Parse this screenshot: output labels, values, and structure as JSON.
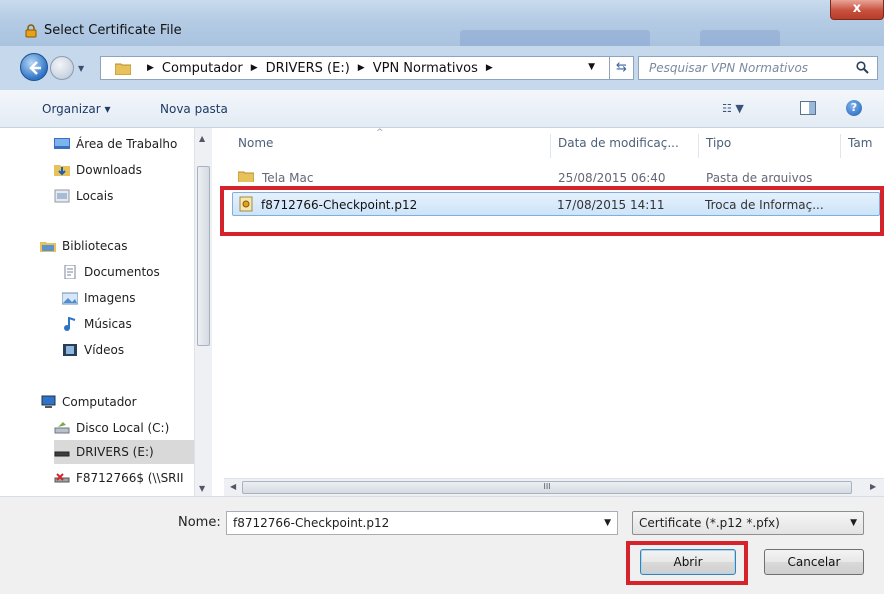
{
  "window": {
    "title": "Select Certificate File",
    "close_label": "x"
  },
  "address": {
    "path": [
      "Computador",
      "DRIVERS (E:)",
      "VPN Normativos"
    ],
    "search_placeholder": "Pesquisar VPN Normativos"
  },
  "toolbar": {
    "organize": "Organizar ▾",
    "new_folder": "Nova pasta"
  },
  "nav": {
    "items": [
      {
        "label": "Área de Trabalho",
        "icon": "desktop-icon"
      },
      {
        "label": "Downloads",
        "icon": "downloads-icon"
      },
      {
        "label": "Locais",
        "icon": "places-icon"
      },
      {
        "label": "Bibliotecas",
        "icon": "libraries-icon"
      },
      {
        "label": "Documentos",
        "icon": "documents-icon"
      },
      {
        "label": "Imagens",
        "icon": "images-icon"
      },
      {
        "label": "Músicas",
        "icon": "music-icon"
      },
      {
        "label": "Vídeos",
        "icon": "videos-icon"
      },
      {
        "label": "Computador",
        "icon": "computer-icon"
      },
      {
        "label": "Disco Local (C:)",
        "icon": "disk-icon"
      },
      {
        "label": "DRIVERS (E:)",
        "icon": "drive-icon"
      },
      {
        "label": "F8712766$ (\\\\SRII",
        "icon": "network-drive-icon"
      }
    ]
  },
  "columns": {
    "name": "Nome",
    "date": "Data de modificaç...",
    "type": "Tipo",
    "size": "Tam"
  },
  "files": [
    {
      "name": "Tela Mac",
      "date": "25/08/2015 06:40",
      "type": "Pasta de arquivos"
    },
    {
      "name": "f8712766-Checkpoint.p12",
      "date": "17/08/2015 14:11",
      "type": "Troca de Informaç..."
    }
  ],
  "bottom": {
    "filename_label": "Nome:",
    "filename_value": "f8712766-Checkpoint.p12",
    "filetype": "Certificate (*.p12 *.pfx)",
    "open_label": "Abrir",
    "cancel_label": "Cancelar"
  },
  "hscroll_label": "III",
  "colors": {
    "highlight": "#d4232b",
    "selection": "#cce4fa"
  }
}
